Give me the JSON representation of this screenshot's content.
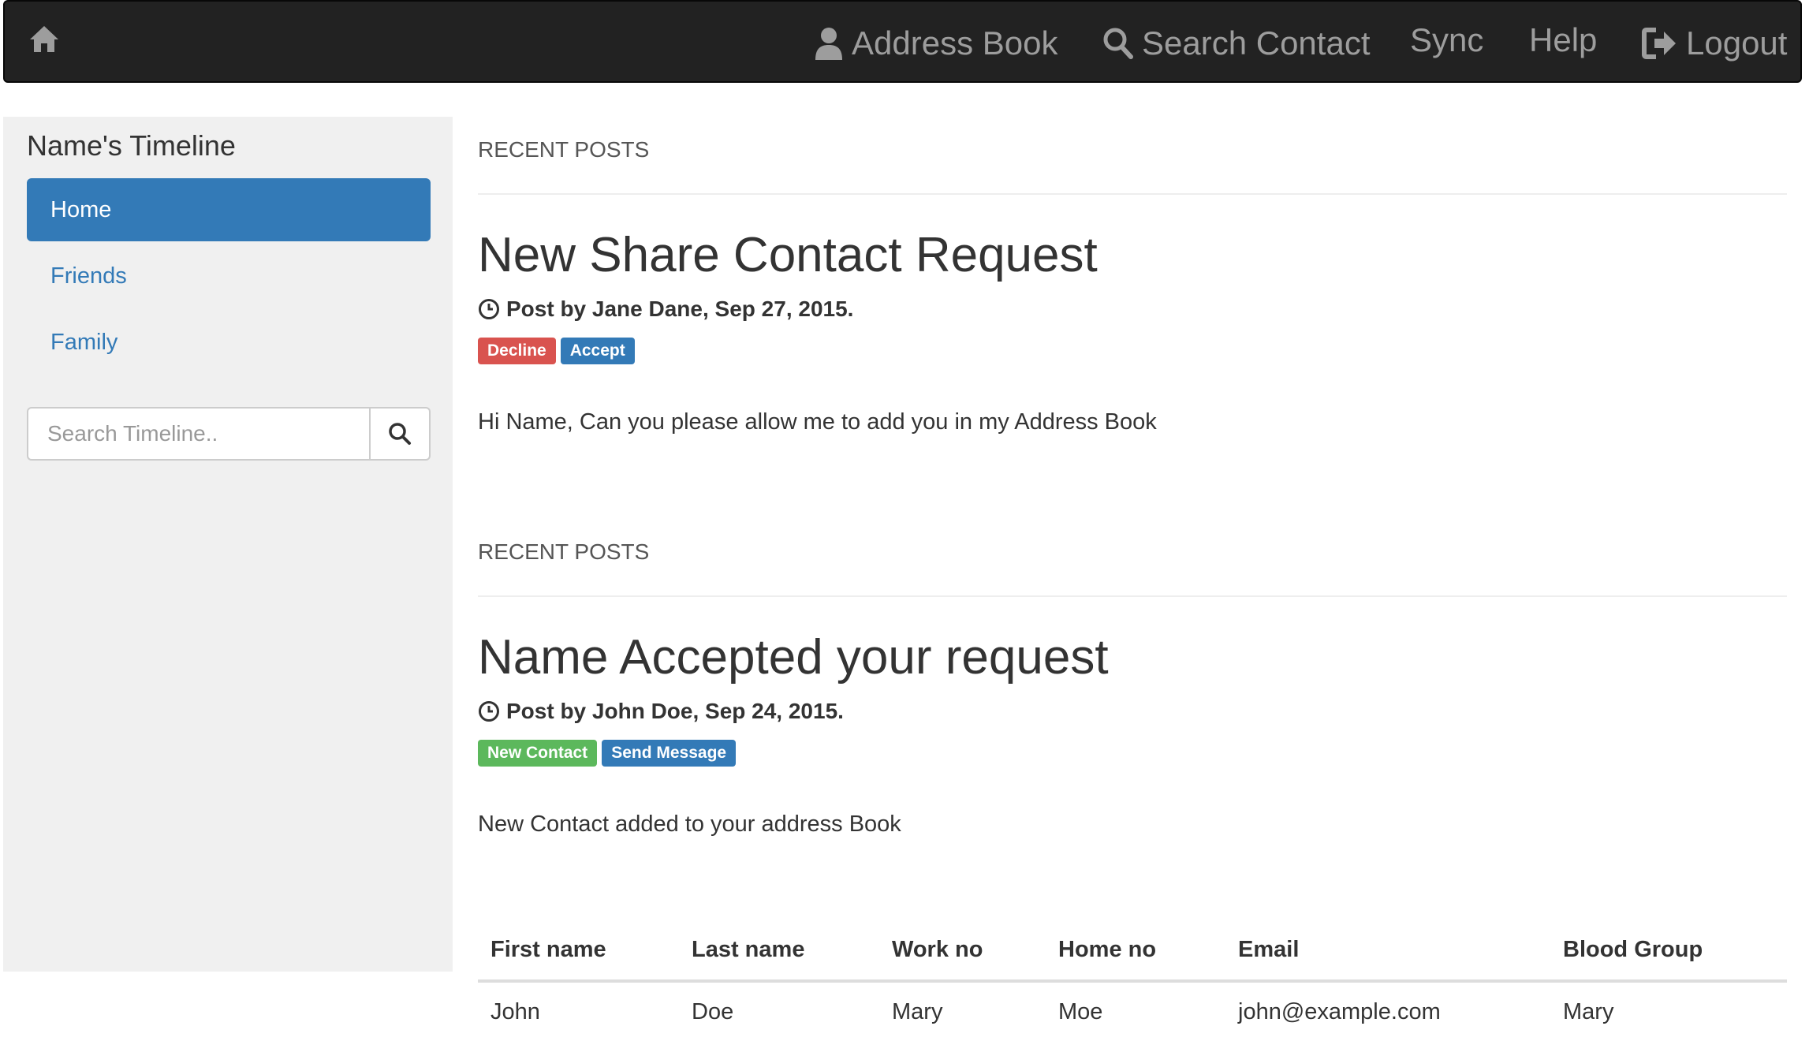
{
  "navbar": {
    "home_icon": "home-icon",
    "items": [
      {
        "label": "Address Book",
        "icon": "user-icon"
      },
      {
        "label": "Search Contact",
        "icon": "search-icon"
      },
      {
        "label": "Sync"
      },
      {
        "label": "Help"
      },
      {
        "label": "Logout",
        "icon": "logout-icon"
      }
    ]
  },
  "sidebar": {
    "title": "Name's Timeline",
    "items": [
      {
        "label": "Home",
        "active": true
      },
      {
        "label": "Friends"
      },
      {
        "label": "Family"
      }
    ],
    "search": {
      "placeholder": "Search Timeline..",
      "value": "",
      "button_icon": "search-icon"
    }
  },
  "main": {
    "posts": [
      {
        "section_label": "RECENT POSTS",
        "title": "New Share Contact Request",
        "meta": "Post by Jane Dane, Sep 27, 2015.",
        "meta_icon": "clock-icon",
        "actions": [
          "Decline",
          "Accept"
        ],
        "body": "Hi Name, Can you please allow me to add you in my Address Book"
      },
      {
        "section_label": "RECENT POSTS",
        "title": "Name Accepted your request",
        "meta": "Post by John Doe, Sep 24, 2015.",
        "meta_icon": "clock-icon",
        "actions": [
          "New Contact",
          "Send Message"
        ],
        "body": "New Contact added to your address Book"
      }
    ],
    "table": {
      "headers": [
        "First name",
        "Last name",
        "Work no",
        "Home no",
        "Email",
        "Blood Group"
      ],
      "rows": [
        [
          "John",
          "Doe",
          "Mary",
          "Moe",
          "john@example.com",
          "Mary"
        ]
      ]
    }
  },
  "colors": {
    "navbar_bg": "#222222",
    "nav_text": "#9d9d9d",
    "primary": "#337ab7",
    "danger": "#d9534f",
    "success": "#5cb85c",
    "sidebar_bg": "#f0f0f0"
  }
}
